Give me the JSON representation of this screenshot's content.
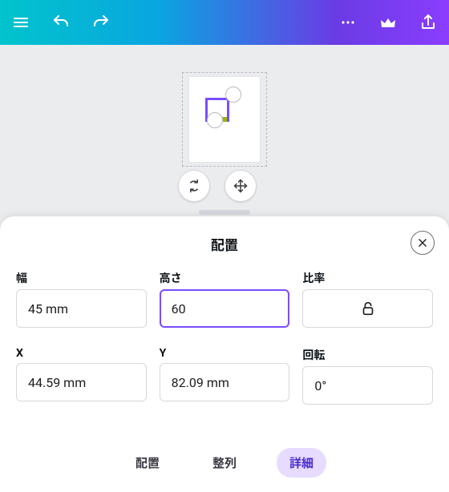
{
  "topbar": {
    "menu_icon": "menu",
    "undo_icon": "undo",
    "redo_icon": "redo",
    "more_icon": "more",
    "crown_icon": "crown",
    "share_icon": "share"
  },
  "canvas": {
    "tool_rotate_icon": "cycle",
    "tool_move_icon": "move"
  },
  "sheet": {
    "title": "配置",
    "close_icon": "close",
    "labels": {
      "width": "幅",
      "height": "高さ",
      "ratio": "比率",
      "x": "X",
      "y": "Y",
      "rotation": "回転"
    },
    "values": {
      "width": "45 mm",
      "height": "60",
      "x": "44.59 mm",
      "y": "82.09 mm",
      "rotation": "0°"
    },
    "ratio_lock_icon": "unlock"
  },
  "tabs": {
    "position": "配置",
    "align": "整列",
    "detail": "詳細",
    "active": "detail"
  }
}
